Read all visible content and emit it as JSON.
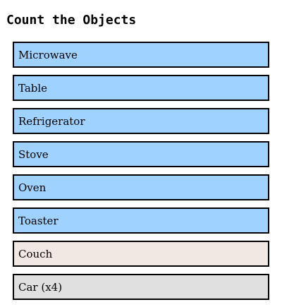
{
  "title": "Count the Objects",
  "items": [
    {
      "label": "Microwave",
      "color": "#a0d2ff"
    },
    {
      "label": "Table",
      "color": "#a0d2ff"
    },
    {
      "label": "Refrigerator",
      "color": "#a0d2ff"
    },
    {
      "label": "Stove",
      "color": "#a0d2ff"
    },
    {
      "label": "Oven",
      "color": "#a0d2ff"
    },
    {
      "label": "Toaster",
      "color": "#a0d2ff"
    },
    {
      "label": "Couch",
      "color": "#f2e8e3"
    },
    {
      "label": "Car (x4)",
      "color": "#e0e0e0"
    }
  ]
}
